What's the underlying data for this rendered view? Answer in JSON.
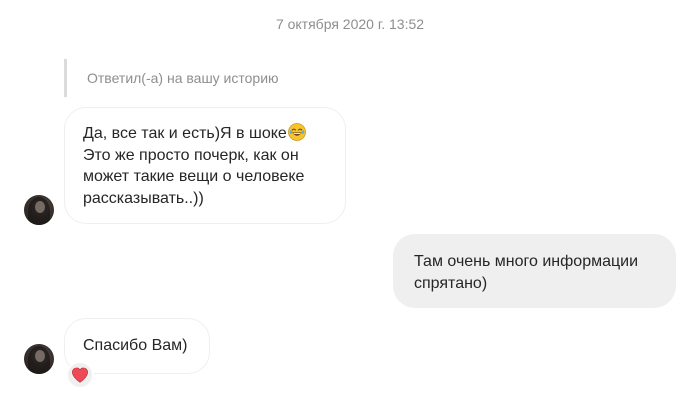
{
  "conversation": {
    "timestamp": "7 октября 2020 г. 13:52",
    "reply_note": "Ответил(-а) на вашу историю",
    "messages": [
      {
        "sender": "contact",
        "lines": [
          "Да, все так и есть)Я в шоке",
          "Это же просто почерк, как он",
          "может такие вещи о человеке",
          "рассказывать..))"
        ],
        "emoji": "laughing-emoji"
      },
      {
        "sender": "me",
        "lines": [
          "Там очень много информации",
          "спрятано)"
        ]
      },
      {
        "sender": "contact",
        "lines": [
          "Спасибо Вам)"
        ],
        "reaction": "heart-icon"
      }
    ]
  },
  "colors": {
    "incoming_bg": "#ffffff",
    "incoming_border": "#efefef",
    "outgoing_bg": "#efefef",
    "meta_text": "#8e8e8e",
    "text": "#262626",
    "heart": "#ed4956"
  }
}
